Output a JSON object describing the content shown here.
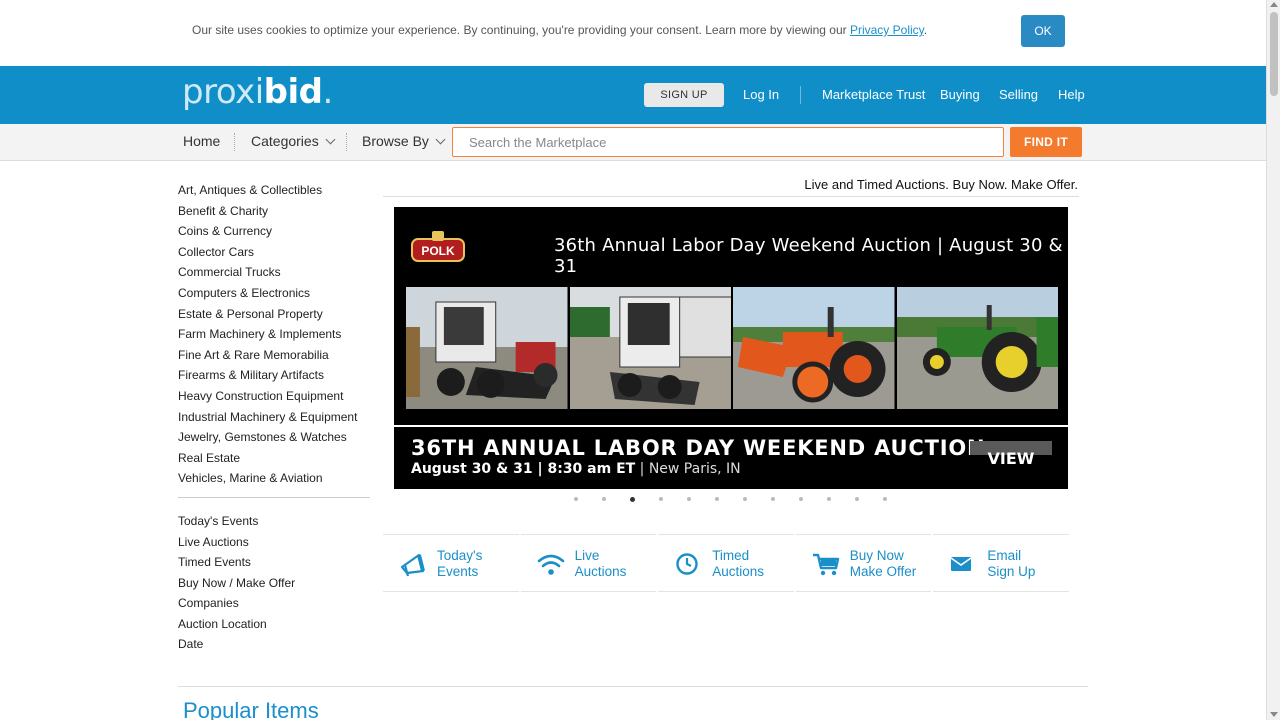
{
  "cookie": {
    "text": "Our site uses cookies to optimize your experience. By continuing, you're providing your consent. Learn more by viewing our ",
    "link": "Privacy Policy",
    "after": ".",
    "ok": "OK"
  },
  "header": {
    "logo_light": "proxi",
    "logo_bold": "bid",
    "logo_dot": ".",
    "signup": "SIGN UP",
    "login": "Log In",
    "links": [
      "Marketplace Trust",
      "Buying",
      "Selling",
      "Help"
    ]
  },
  "nav": {
    "home": "Home",
    "categories": "Categories",
    "browse": "Browse By",
    "search_placeholder": "Search the Marketplace",
    "find": "FIND IT"
  },
  "sidebar": {
    "categories": [
      "Art, Antiques & Collectibles",
      "Benefit & Charity",
      "Coins & Currency",
      "Collector Cars",
      "Commercial Trucks",
      "Computers & Electronics",
      "Estate & Personal Property",
      "Farm Machinery & Implements",
      "Fine Art & Rare Memorabilia",
      "Firearms & Military Artifacts",
      "Heavy Construction Equipment",
      "Industrial Machinery & Equipment",
      "Jewelry, Gemstones & Watches",
      "Real Estate",
      "Vehicles, Marine & Aviation"
    ],
    "browse": [
      "Today's Events",
      "Live Auctions",
      "Timed Events",
      "Buy Now / Make Offer",
      "Companies",
      "Auction Location",
      "Date"
    ]
  },
  "main": {
    "tagline": "Live and Timed Auctions. Buy Now. Make Offer.",
    "banner": {
      "heading": "36th Annual Labor Day Weekend Auction  |  August 30 & 31",
      "title": "36TH ANNUAL LABOR DAY WEEKEND AUCTION",
      "date_time": "August 30 & 31 | 8:30 am ET",
      "place": " | New Paris, IN",
      "view": "VIEW",
      "logo_text": "POLK"
    },
    "carousel": {
      "count": 12,
      "active_index": 2
    },
    "quick_links": [
      {
        "line1": "Today's",
        "line2": "Events",
        "icon": "megaphone-icon"
      },
      {
        "line1": "Live",
        "line2": "Auctions",
        "icon": "wifi-icon"
      },
      {
        "line1": "Timed",
        "line2": "Auctions",
        "icon": "clock-icon"
      },
      {
        "line1": "Buy Now",
        "line2": "Make Offer",
        "icon": "cart-icon"
      },
      {
        "line1": "Email",
        "line2": "Sign Up",
        "icon": "envelope-icon"
      }
    ],
    "popular_heading": "Popular Items"
  },
  "colors": {
    "brand_blue": "#0f8ec7",
    "link_blue": "#1a8fc9",
    "accent_orange": "#f47a2e"
  }
}
